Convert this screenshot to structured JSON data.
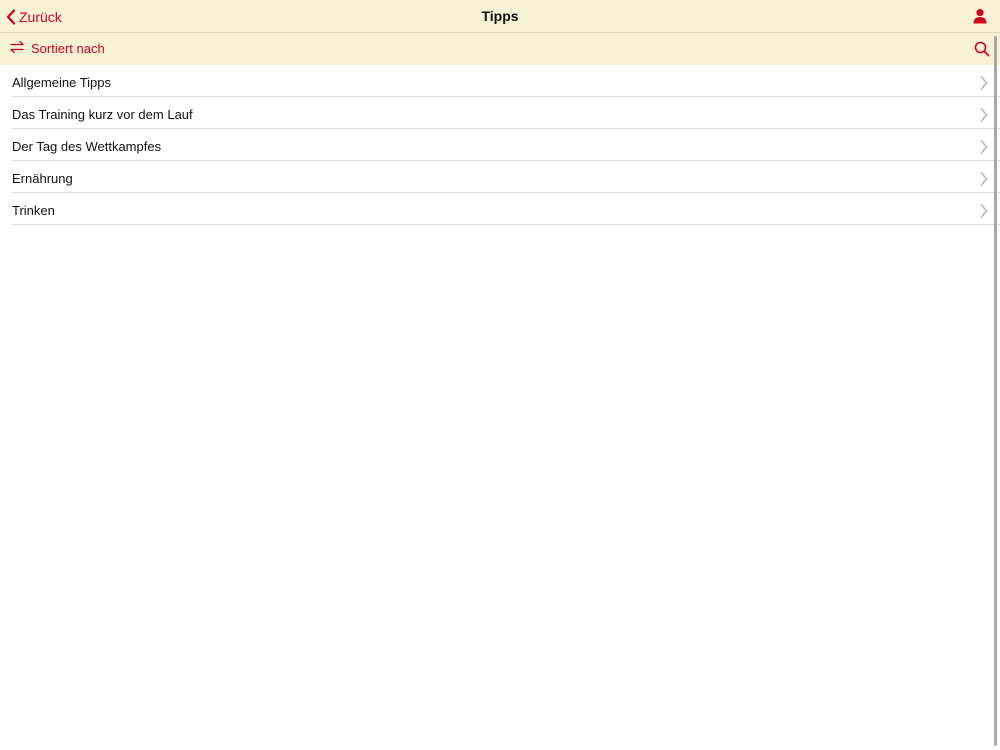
{
  "navbar": {
    "back_label": "Zurück",
    "back_icon": "chevron-left-icon",
    "title": "Tipps",
    "profile_icon": "person-icon"
  },
  "toolbar": {
    "sort_label": "Sortiert nach",
    "sort_icon": "swap-arrows-icon",
    "search_icon": "search-icon"
  },
  "colors": {
    "accent": "#d0021b",
    "bar_background": "#f7f2d6",
    "separator": "#dcdcdc",
    "text": "#111111"
  },
  "list": {
    "items": [
      {
        "label": "Allgemeine Tipps"
      },
      {
        "label": "Das Training kurz vor dem Lauf"
      },
      {
        "label": "Der Tag des Wettkampfes"
      },
      {
        "label": "Ernährung"
      },
      {
        "label": "Trinken"
      }
    ]
  }
}
